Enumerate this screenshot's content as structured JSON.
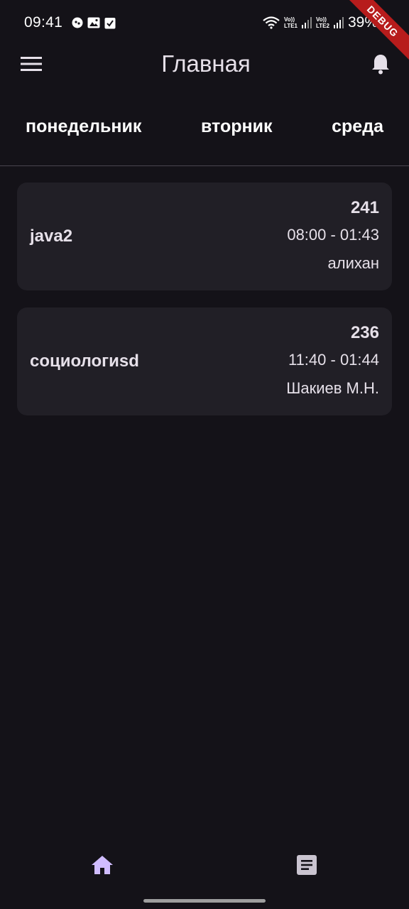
{
  "status_bar": {
    "time": "09:41",
    "lte1": [
      "Vo))",
      "LTE1"
    ],
    "lte2": [
      "Vo))",
      "LTE2"
    ],
    "battery": "39%"
  },
  "debug_banner": "DEBUG",
  "app_bar": {
    "title": "Главная",
    "menu_icon": "menu-icon",
    "bell_icon": "bell-icon"
  },
  "tabs": [
    {
      "label": "понедельник"
    },
    {
      "label": "вторник"
    },
    {
      "label": "среда"
    }
  ],
  "lessons": [
    {
      "title": "java2",
      "room": "241",
      "time": "08:00 - 01:43",
      "teacher": "алихан"
    },
    {
      "title": "социологиsd",
      "room": "236",
      "time": "11:40 - 01:44",
      "teacher": "Шакиев М.Н."
    }
  ],
  "bottom_nav": {
    "items": [
      {
        "icon": "home-icon",
        "active": true
      },
      {
        "icon": "article-icon",
        "active": false
      }
    ]
  },
  "colors": {
    "background": "#141218",
    "card": "#211f26",
    "accent": "#d0bcff",
    "inactive_icon": "#cac4d0",
    "debug": "#b71c1c"
  }
}
